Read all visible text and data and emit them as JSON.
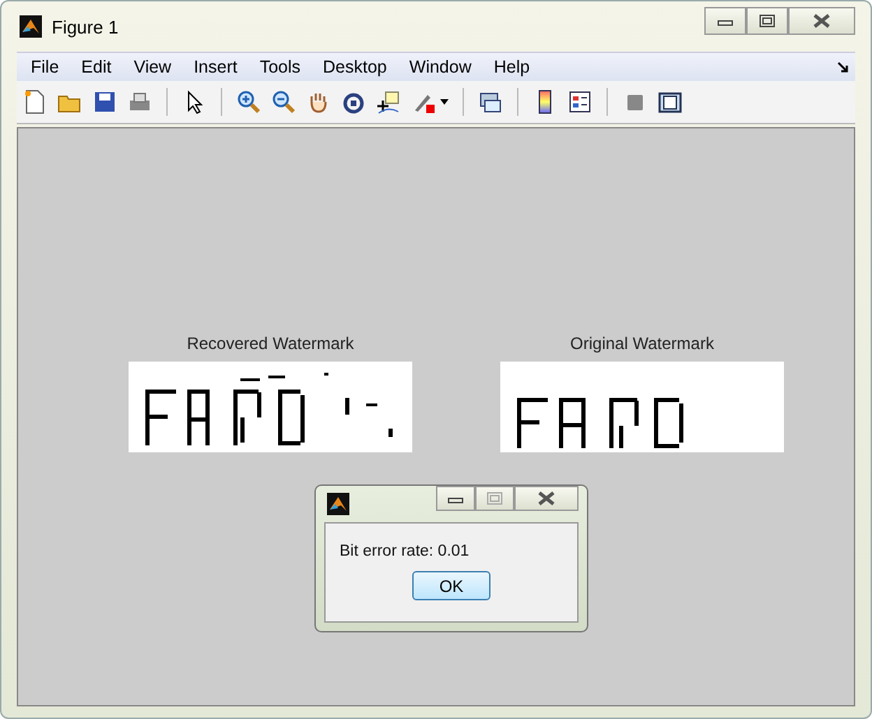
{
  "window": {
    "title": "Figure 1"
  },
  "menu": [
    "File",
    "Edit",
    "View",
    "Insert",
    "Tools",
    "Desktop",
    "Window",
    "Help"
  ],
  "axes": [
    {
      "title": "Recovered Watermark",
      "kind": "picture"
    },
    {
      "title": "Original Watermark",
      "kind": "picture"
    }
  ],
  "dialog": {
    "message": "Bit error rate: 0.01",
    "button": "OK"
  }
}
